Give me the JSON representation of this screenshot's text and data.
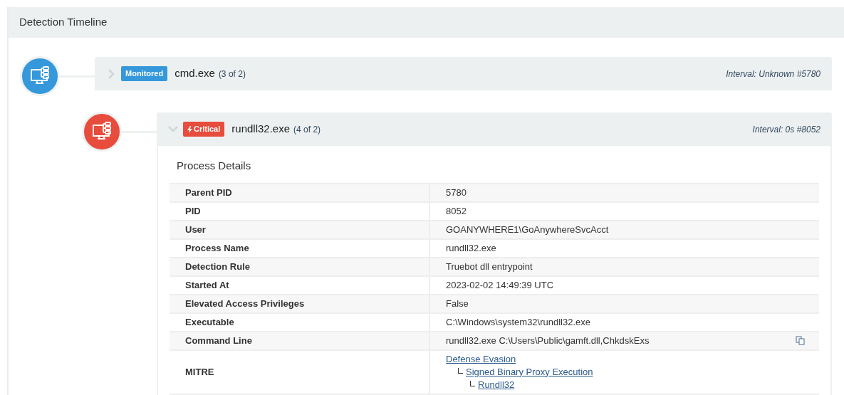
{
  "panel": {
    "title": "Detection Timeline"
  },
  "nodes": [
    {
      "kind": "monitored",
      "badge": "Monitored",
      "name": "cmd.exe",
      "count": "(3 of 2)",
      "interval": "Interval: Unknown #5780",
      "expanded": false
    },
    {
      "kind": "critical",
      "badge": "Critical",
      "name": "rundll32.exe",
      "count": "(4 of 2)",
      "interval": "Interval: 0s #8052",
      "expanded": true,
      "details": {
        "title": "Process Details",
        "rows": [
          {
            "kind": "text",
            "label": "Parent PID",
            "value": "5780",
            "copyable": false
          },
          {
            "kind": "text",
            "label": "PID",
            "value": "8052",
            "copyable": false
          },
          {
            "kind": "text",
            "label": "User",
            "value": "GOANYWHERE1\\GoAnywhereSvcAcct",
            "copyable": false
          },
          {
            "kind": "text",
            "label": "Process Name",
            "value": "rundll32.exe",
            "copyable": false
          },
          {
            "kind": "text",
            "label": "Detection Rule",
            "value": "Truebot dll entrypoint",
            "copyable": false
          },
          {
            "kind": "text",
            "label": "Started At",
            "value": "2023-02-02 14:49:39 UTC",
            "copyable": false
          },
          {
            "kind": "text",
            "label": "Elevated Access Privileges",
            "value": "False",
            "copyable": false
          },
          {
            "kind": "text",
            "label": "Executable",
            "value": "C:\\Windows\\system32\\rundll32.exe",
            "copyable": false
          },
          {
            "kind": "text",
            "label": "Command Line",
            "value": "rundll32.exe C:\\Users\\Public\\gamft.dll,ChkdskExs",
            "copyable": true
          },
          {
            "kind": "mitre",
            "label": "MITRE",
            "links": [
              {
                "label": "Defense Evasion",
                "children": [
                  {
                    "label": "Signed Binary Proxy Execution",
                    "children": [
                      {
                        "label": "Rundll32"
                      }
                    ]
                  }
                ]
              }
            ]
          }
        ]
      }
    }
  ]
}
